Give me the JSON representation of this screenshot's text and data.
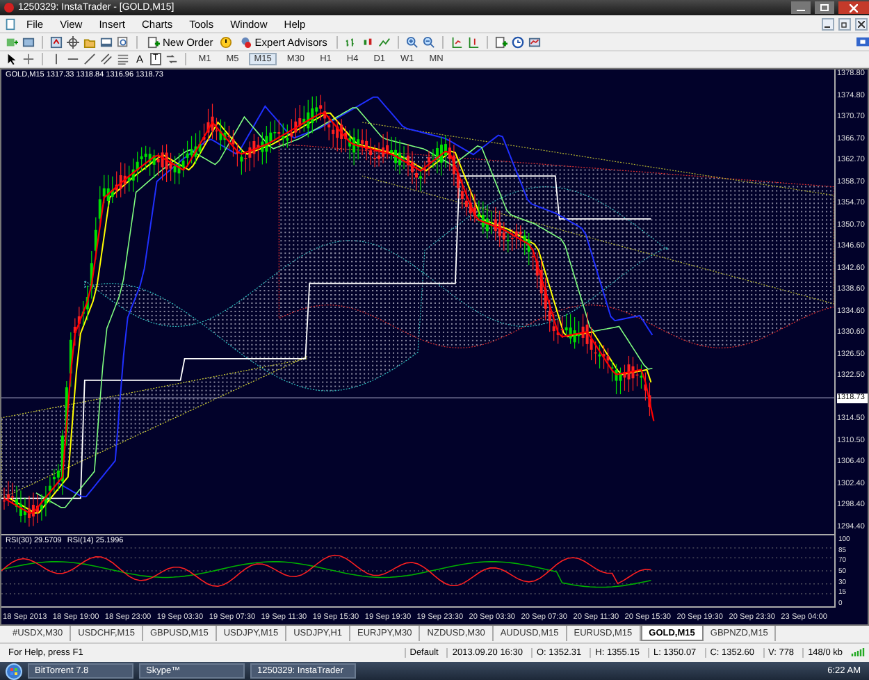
{
  "window": {
    "title": "1250329: InstaTrader - [GOLD,M15]"
  },
  "menu": [
    "File",
    "View",
    "Insert",
    "Charts",
    "Tools",
    "Window",
    "Help"
  ],
  "toolbar": {
    "new_order": "New Order",
    "expert_advisors": "Expert Advisors"
  },
  "drawing_tools": {
    "text_tool": "A",
    "label_tool": "T"
  },
  "timeframes": [
    {
      "label": "M1",
      "selected": false
    },
    {
      "label": "M5",
      "selected": false
    },
    {
      "label": "M15",
      "selected": true
    },
    {
      "label": "M30",
      "selected": false
    },
    {
      "label": "H1",
      "selected": false
    },
    {
      "label": "H4",
      "selected": false
    },
    {
      "label": "D1",
      "selected": false
    },
    {
      "label": "W1",
      "selected": false
    },
    {
      "label": "MN",
      "selected": false
    }
  ],
  "chart": {
    "header": "GOLD,M15  1317.33 1318.84 1316.96 1318.73",
    "price_axis": [
      {
        "label": "1378.80",
        "kind": "tick"
      },
      {
        "label": "1374.80",
        "kind": "tick"
      },
      {
        "label": "1370.70",
        "kind": "tick"
      },
      {
        "label": "1366.70",
        "kind": "tick"
      },
      {
        "label": "1362.70",
        "kind": "tick"
      },
      {
        "label": "1358.70",
        "kind": "tick"
      },
      {
        "label": "1354.70",
        "kind": "tick"
      },
      {
        "label": "1350.70",
        "kind": "tick"
      },
      {
        "label": "1346.60",
        "kind": "tick"
      },
      {
        "label": "1342.60",
        "kind": "tick"
      },
      {
        "label": "1338.60",
        "kind": "tick"
      },
      {
        "label": "1334.60",
        "kind": "tick"
      },
      {
        "label": "1330.60",
        "kind": "tick"
      },
      {
        "label": "1326.50",
        "kind": "tick"
      },
      {
        "label": "1322.50",
        "kind": "tick"
      },
      {
        "label": "1318.73",
        "kind": "current"
      },
      {
        "label": "1314.50",
        "kind": "tick"
      },
      {
        "label": "1310.50",
        "kind": "tick"
      },
      {
        "label": "1306.40",
        "kind": "tick"
      },
      {
        "label": "1302.40",
        "kind": "tick"
      },
      {
        "label": "1298.40",
        "kind": "tick"
      },
      {
        "label": "1294.40",
        "kind": "tick"
      }
    ],
    "rsi_labels": [
      "RSI(30) 29.5709",
      "RSI(14) 25.1996"
    ],
    "rsi_axis": [
      "100",
      "85",
      "70",
      "50",
      "30",
      "15",
      "0"
    ],
    "time_axis": [
      "18 Sep 2013",
      "18 Sep 19:00",
      "18 Sep 23:00",
      "19 Sep 03:30",
      "19 Sep 07:30",
      "19 Sep 11:30",
      "19 Sep 15:30",
      "19 Sep 19:30",
      "19 Sep 23:30",
      "20 Sep 03:30",
      "20 Sep 07:30",
      "20 Sep 11:30",
      "20 Sep 15:30",
      "20 Sep 19:30",
      "20 Sep 23:30",
      "23 Sep 04:00"
    ]
  },
  "chart_tabs": [
    {
      "label": "#USDX,M30",
      "selected": false
    },
    {
      "label": "USDCHF,M15",
      "selected": false
    },
    {
      "label": "GBPUSD,M15",
      "selected": false
    },
    {
      "label": "USDJPY,M15",
      "selected": false
    },
    {
      "label": "USDJPY,H1",
      "selected": false
    },
    {
      "label": "EURJPY,M30",
      "selected": false
    },
    {
      "label": "NZDUSD,M30",
      "selected": false
    },
    {
      "label": "AUDUSD,M15",
      "selected": false
    },
    {
      "label": "EURUSD,M15",
      "selected": false
    },
    {
      "label": "GOLD,M15",
      "selected": true
    },
    {
      "label": "GBPNZD,M15",
      "selected": false
    }
  ],
  "status_bar": [
    "For Help, press F1",
    "Default",
    "2013.09.20 16:30",
    "O: 1352.31",
    "H: 1355.15",
    "L: 1350.07",
    "C: 1352.60",
    "V: 778",
    "148/0 kb"
  ],
  "taskbar": {
    "buttons": [
      "BitTorrent 7.8",
      "Skype™",
      "1250329: InstaTrader"
    ],
    "clock": "6:22 AM"
  }
}
